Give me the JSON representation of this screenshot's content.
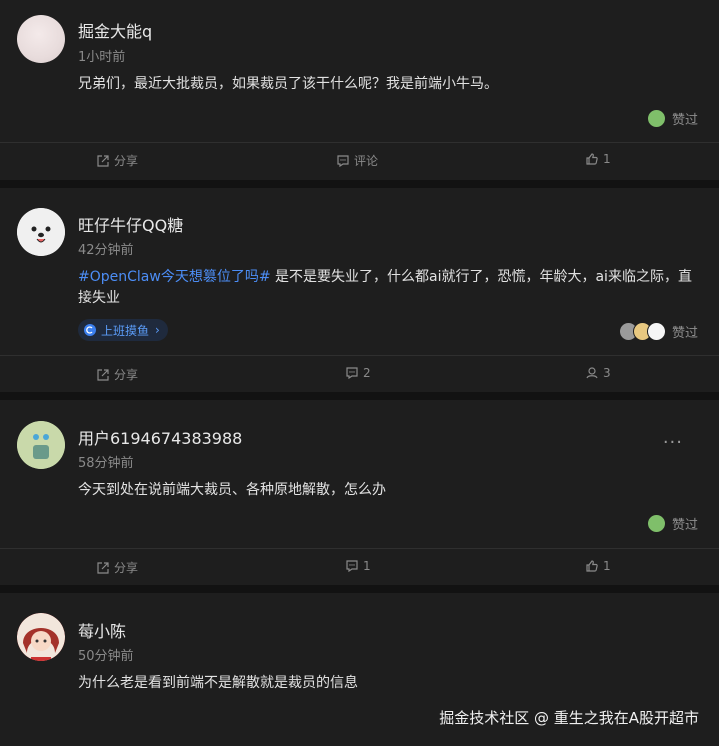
{
  "posts": [
    {
      "username": "掘金大能q",
      "time": "1小时前",
      "content": "兄弟们，最近大批裁员，如果裁员了该干什么呢？我是前端小牛马。",
      "like_label": "赞过",
      "actions": {
        "share": "分享",
        "comment": "评论",
        "like": "1"
      }
    },
    {
      "username": "旺仔牛仔QQ糖",
      "time": "42分钟前",
      "hashtag": "#OpenClaw今天想篡位了吗#",
      "content": " 是不是要失业了，什么都ai就行了，恐慌，年龄大，ai来临之际，直接失业",
      "topic": "上班摸鱼",
      "like_label": "赞过",
      "actions": {
        "share": "分享",
        "comment": "2",
        "like": "3"
      }
    },
    {
      "username": "用户6194674383988",
      "time": "58分钟前",
      "content": "今天到处在说前端大裁员、各种原地解散，怎么办",
      "like_label": "赞过",
      "more": "···",
      "actions": {
        "share": "分享",
        "comment": "1",
        "like": "1"
      }
    },
    {
      "username": "莓小陈",
      "time": "50分钟前",
      "content": "为什么老是看到前端不是解散就是裁员的信息"
    }
  ],
  "watermark": "掘金技术社区 @ 重生之我在A股开超市",
  "colors": {
    "background": "#121212",
    "card": "#1e1e1e",
    "hashtag": "#4c8df5",
    "muted": "#8a8a8a"
  }
}
